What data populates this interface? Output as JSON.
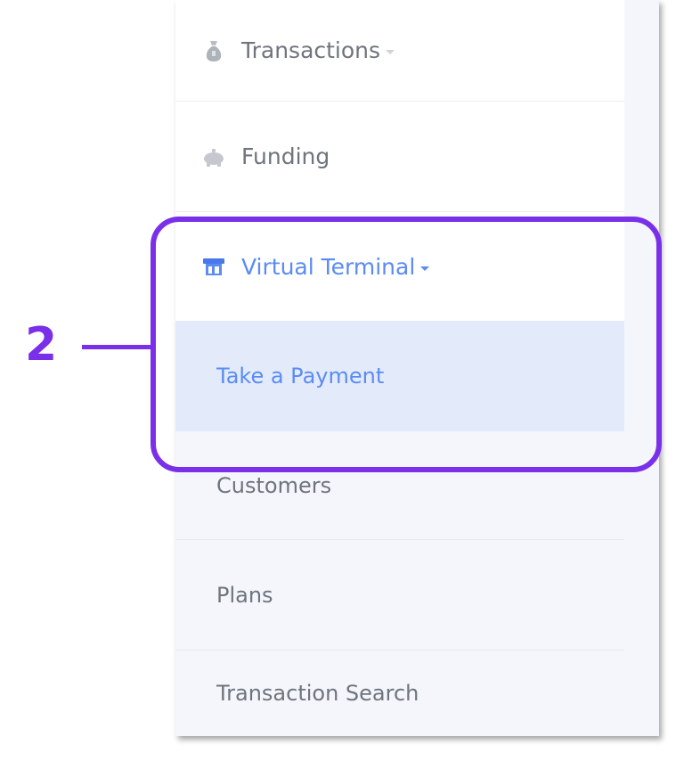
{
  "menu": {
    "transactions_label": "Transactions",
    "funding_label": "Funding",
    "virtual_terminal_label": "Virtual Terminal",
    "sub_items": [
      {
        "label": "Take a Payment",
        "active": true
      },
      {
        "label": "Customers",
        "active": false
      },
      {
        "label": "Plans",
        "active": false
      },
      {
        "label": "Transaction Search",
        "active": false
      }
    ]
  },
  "annotation": {
    "number": "2",
    "color": "#7a30e8"
  },
  "icons": {
    "transactions": "money-bag-icon",
    "funding": "piggy-bank-icon",
    "virtual_terminal": "terminal-icon"
  },
  "colors": {
    "accent": "#5b8bf5",
    "active_bg": "#e3ebfb",
    "text_muted": "#6f747d"
  }
}
